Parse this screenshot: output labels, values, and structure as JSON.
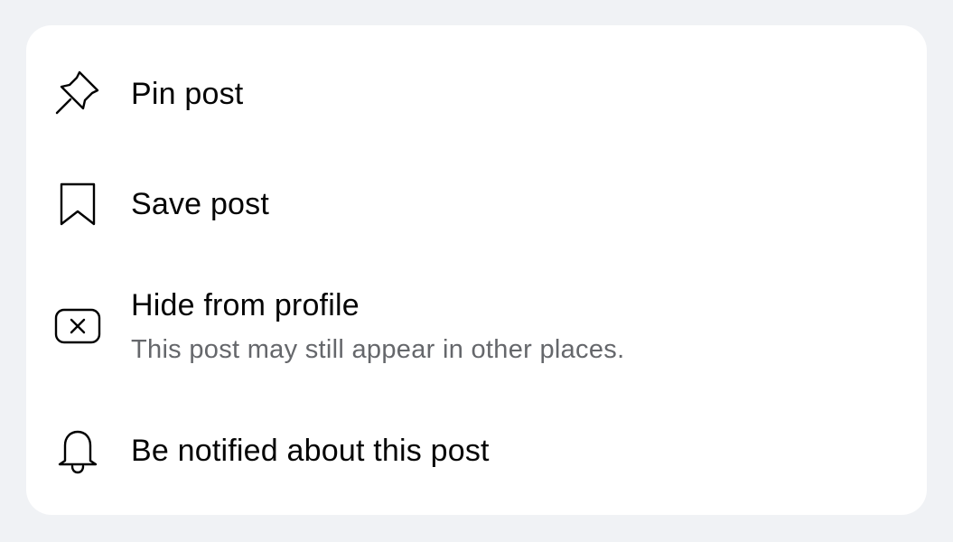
{
  "menu": {
    "items": [
      {
        "label": "Pin post",
        "icon": "pin-icon"
      },
      {
        "label": "Save post",
        "icon": "bookmark-icon"
      },
      {
        "label": "Hide from profile",
        "sublabel": "This post may still appear in other places.",
        "icon": "hide-x-icon"
      },
      {
        "label": "Be notified about this post",
        "icon": "bell-icon"
      }
    ]
  },
  "colors": {
    "background": "#f0f2f5",
    "sheet": "#ffffff",
    "text_primary": "#050505",
    "text_secondary": "#65676b"
  }
}
